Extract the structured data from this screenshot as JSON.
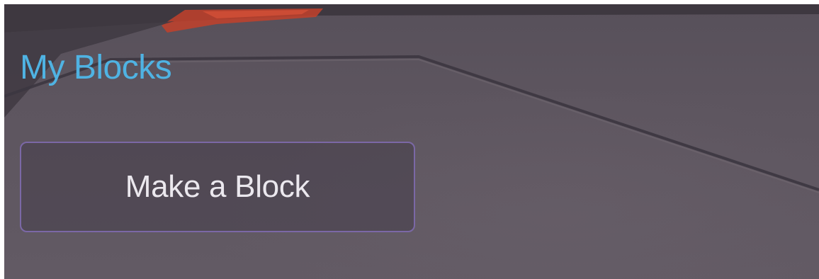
{
  "palette": {
    "title_color": "#4fb3e3",
    "button_border": "#7b68a6",
    "button_text": "#ebe8ee",
    "background": "#5d555f",
    "accent_red": "#c2412c"
  },
  "palette_section": {
    "title": "My Blocks",
    "make_block_label": "Make a Block"
  }
}
